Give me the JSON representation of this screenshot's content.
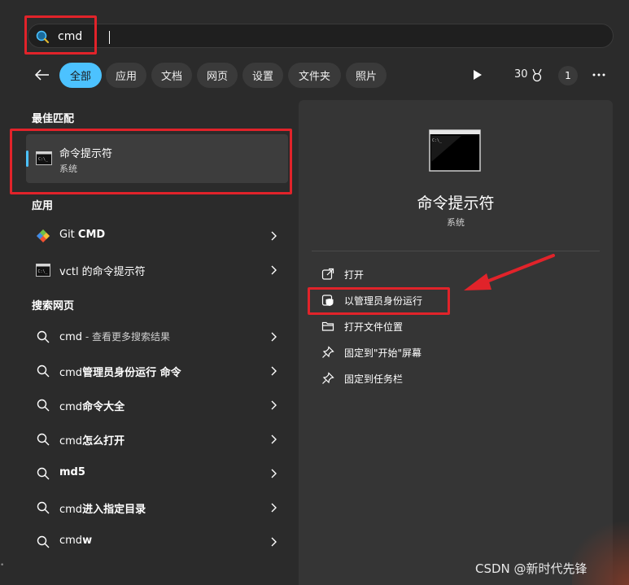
{
  "search": {
    "query": "cmd"
  },
  "filters": {
    "items": [
      "全部",
      "应用",
      "文档",
      "网页",
      "设置",
      "文件夹",
      "照片"
    ],
    "active": "全部"
  },
  "header_right": {
    "points": "30",
    "badge": "1"
  },
  "best_match": {
    "section": "最佳匹配",
    "title": "命令提示符",
    "subtitle": "系统"
  },
  "apps": {
    "section": "应用",
    "items": [
      {
        "prefix": "Git ",
        "bold": "CMD"
      },
      {
        "prefix": "vctl 的命令提示符",
        "bold": ""
      }
    ]
  },
  "web": {
    "section": "搜索网页",
    "items": [
      {
        "text": "cmd",
        "sub": " - 查看更多搜索结果"
      },
      {
        "text": "cmd",
        "bold": "管理员身份运行 命令"
      },
      {
        "text": "cmd",
        "bold": "命令大全"
      },
      {
        "text": "cmd",
        "bold": "怎么打开"
      },
      {
        "text": "",
        "bold": "md5"
      },
      {
        "text": "cmd",
        "bold": "进入指定目录"
      },
      {
        "text": "cmd",
        "bold": "w"
      }
    ]
  },
  "detail": {
    "title": "命令提示符",
    "subtitle": "系统",
    "actions": [
      "打开",
      "以管理员身份运行",
      "打开文件位置",
      "固定到\"开始\"屏幕",
      "固定到任务栏"
    ]
  },
  "watermark": "CSDN @新时代先锋",
  "colors": {
    "accent": "#4cc2ff",
    "highlight": "#e1232a"
  }
}
